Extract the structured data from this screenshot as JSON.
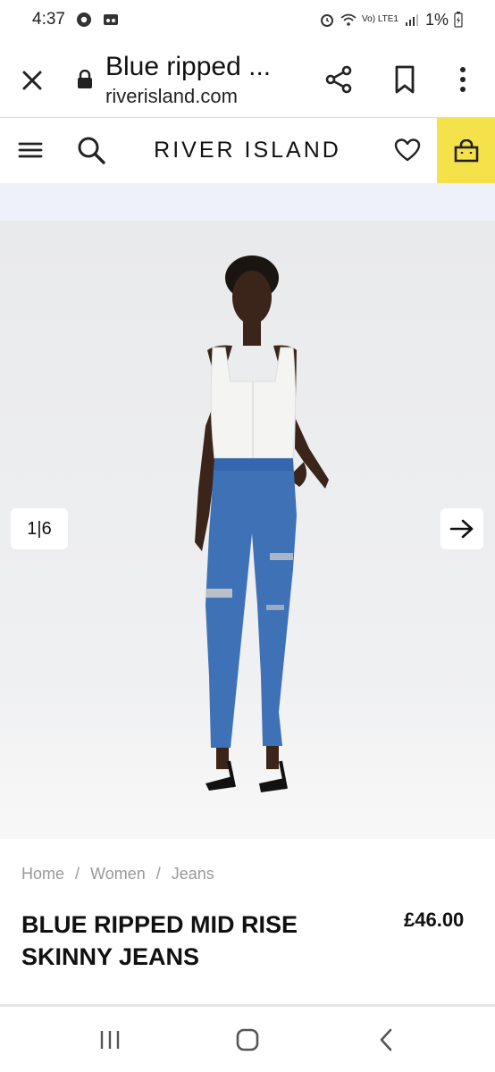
{
  "status_bar": {
    "time": "4:37",
    "network": "Vo) LTE1",
    "battery": "1%"
  },
  "browser": {
    "page_title": "Blue ripped ...",
    "url": "riverisland.com"
  },
  "site_header": {
    "logo": "RIVER ISLAND",
    "bag_color": "#f5e14a"
  },
  "gallery": {
    "counter": "1|6"
  },
  "breadcrumb": {
    "items": [
      "Home",
      "Women",
      "Jeans"
    ],
    "separator": "/"
  },
  "product": {
    "name": "BLUE RIPPED MID RISE SKINNY JEANS",
    "price": "£46.00"
  }
}
